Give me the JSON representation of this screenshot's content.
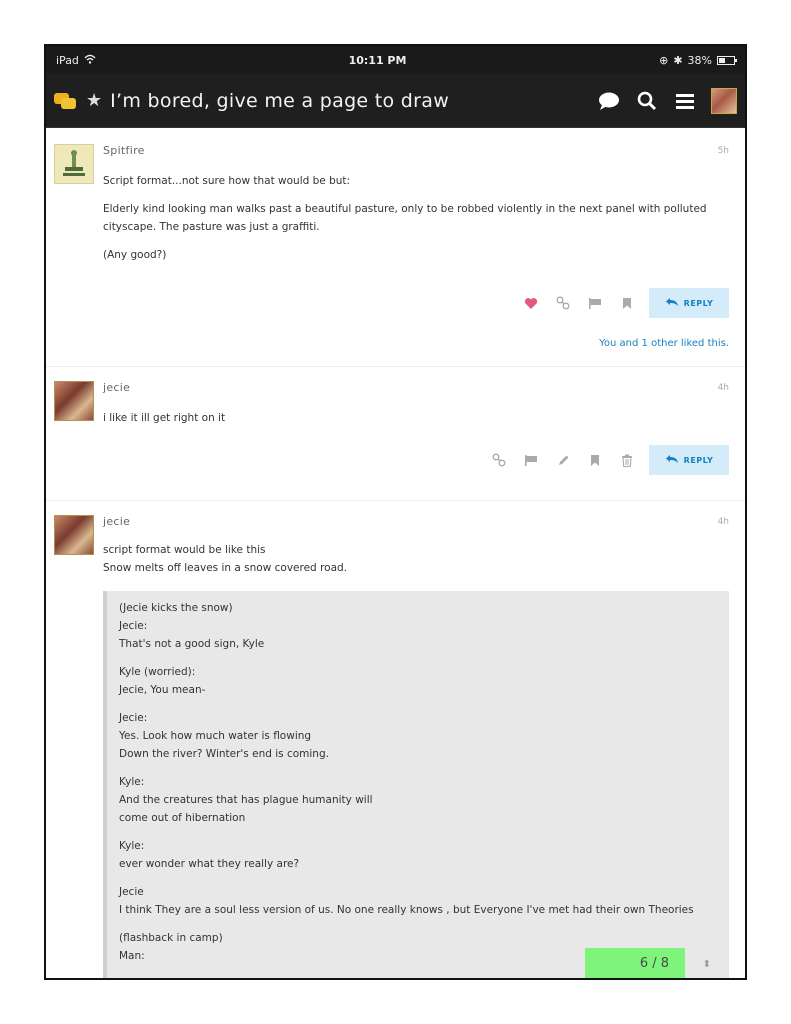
{
  "status_bar": {
    "device": "iPad",
    "time": "10:11 PM",
    "battery": "38%",
    "battery_level_percent": 38
  },
  "header": {
    "title": "I’m bored, give me a page to draw"
  },
  "posts": [
    {
      "username": "Spitfire",
      "time": "5h",
      "paragraphs": [
        "Script format...not sure how that would be but:",
        "Elderly kind looking man walks past a beautiful pasture, only to be robbed violently in the next panel with polluted cityscape. The pasture was just a graffiti.",
        "(Any good?)"
      ],
      "reply_label": "REPLY",
      "liked_text": "You and 1 other liked this."
    },
    {
      "username": "jecie",
      "time": "4h",
      "paragraphs": [
        "i like it ill get right on it"
      ],
      "reply_label": "REPLY"
    },
    {
      "username": "jecie",
      "time": "4h",
      "paragraphs": [
        "script format would be like this",
        "Snow melts off leaves in a snow covered road."
      ],
      "quote": [
        "(Jecie kicks the snow)\nJecie:\nThat's not a good sign, Kyle",
        "Kyle (worried):\nJecie, You mean-",
        "Jecie:\nYes. Look how much water is flowing\nDown the river? Winter's end is coming.",
        "Kyle:\nAnd the creatures that has plague humanity will\ncome out of hibernation",
        "Kyle:\never wonder what they really are?",
        "Jecie\nI think They are a soul less version of us. No one really knows , but Everyone I've met had their own Theories",
        "(flashback in camp)\nMan:"
      ]
    }
  ],
  "progress": {
    "label": "6 / 8"
  },
  "colors": {
    "header_bg": "#1f1f1f",
    "reply_bg": "#d4ebf9",
    "link_blue": "#1680c3",
    "like_heart": "#e45a7c",
    "progress_green": "#7ff47a"
  },
  "icons": [
    "wifi-icon",
    "chat-bubble-icon",
    "search-icon",
    "hamburger-menu-icon",
    "heart-icon",
    "link-icon",
    "flag-icon",
    "bookmark-icon",
    "edit-icon",
    "trash-icon",
    "reply-arrow-icon",
    "star-icon"
  ]
}
